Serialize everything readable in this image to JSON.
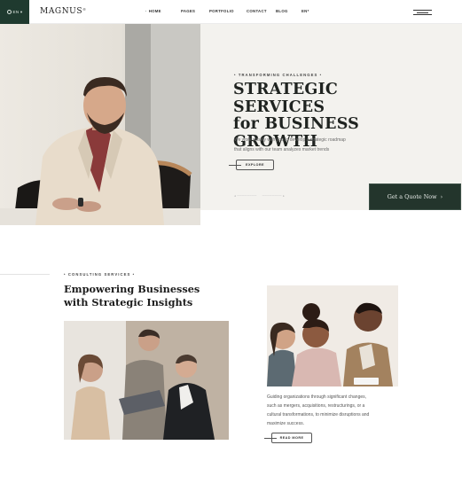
{
  "header": {
    "lang_label": "EN ▾",
    "logo": "MAGNUS",
    "logo_mark": "®",
    "nav": [
      "HOME",
      "PAGES",
      "PORTFOLIO",
      "CONTACT",
      "BLOG",
      "EN*"
    ],
    "menu_icon": "hamburger-menu-icon"
  },
  "hero": {
    "tag": "TRANSFORMING CHALLENGES",
    "title_line1": "STRATEGIC SERVICES",
    "title_line2": "for BUSINESS",
    "title_line3": "GROWTH",
    "desc_line1": "We work closely with you to develop a strategic roadmap",
    "desc_line2": "that aligns with our team analyzes market trends",
    "explore_label": "EXPLORE",
    "quote_label": "Get a Quote Now",
    "quote_arrow": "›"
  },
  "consulting": {
    "tag": "CONSULTING SERVICES",
    "title_line1": "Empowering Businesses",
    "title_line2": "with Strategic Insights",
    "desc_line1": "Guiding organizations through significant changes,",
    "desc_line2": "such as mergers, acquisitions, restructurings, or a",
    "desc_line3": "cultural transformations, to minimize disruptions and",
    "desc_line4": "maximize success.",
    "read_more_label": "READ MORE"
  },
  "colors": {
    "accent": "#1f3a2f",
    "hero_panel": "#f3f2ee",
    "quote_button": "#23352c"
  }
}
